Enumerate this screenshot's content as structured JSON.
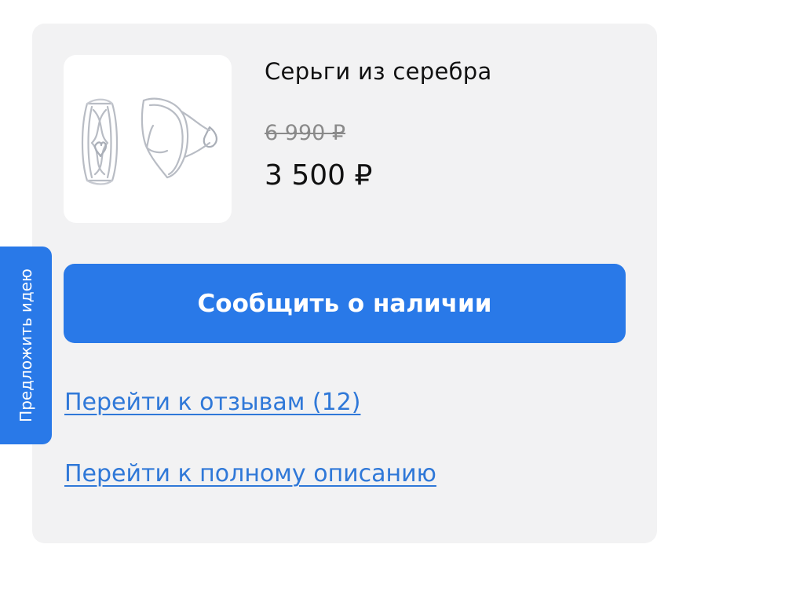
{
  "product": {
    "title": "Серьги из серебра",
    "old_price": "6 990 ₽",
    "new_price": "3 500 ₽",
    "image_icon": "earrings-image"
  },
  "actions": {
    "notify_label": "Сообщить о наличии",
    "reviews_link": "Перейти к отзывам (12)",
    "description_link": "Перейти к полному описанию"
  },
  "side_tab": {
    "label": "Предложить идею"
  },
  "colors": {
    "accent": "#2979e8",
    "link": "#2f78d8",
    "card_background": "#f2f2f3"
  }
}
